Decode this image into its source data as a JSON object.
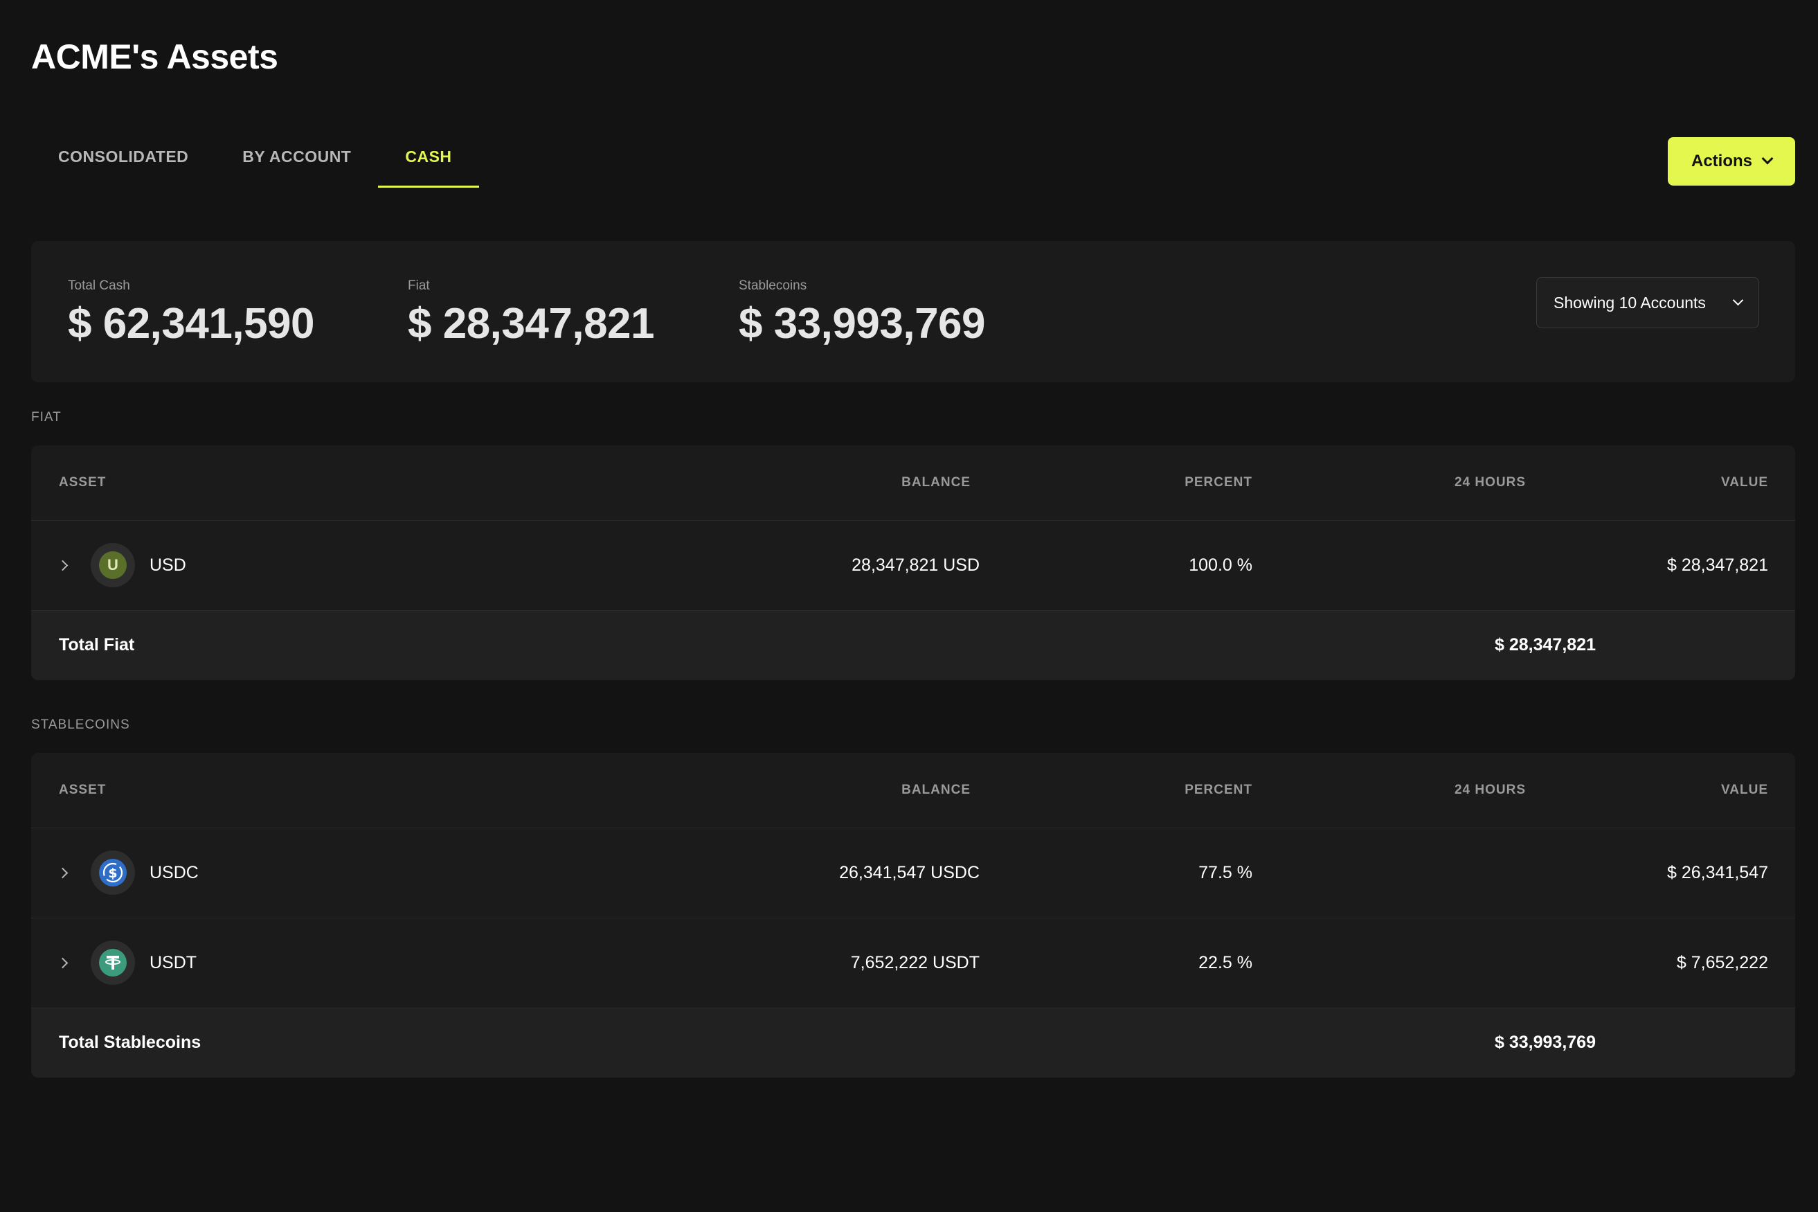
{
  "header": {
    "title": "ACME's Assets"
  },
  "tabs": [
    {
      "label": "CONSOLIDATED",
      "active": false
    },
    {
      "label": "BY ACCOUNT",
      "active": false
    },
    {
      "label": "CASH",
      "active": true
    }
  ],
  "actions": {
    "label": "Actions"
  },
  "summary": {
    "total_cash": {
      "label": "Total Cash",
      "value": "$ 62,341,590"
    },
    "fiat": {
      "label": "Fiat",
      "value": "$ 28,347,821"
    },
    "stablecoins": {
      "label": "Stablecoins",
      "value": "$ 33,993,769"
    },
    "accounts_select": "Showing 10 Accounts"
  },
  "columns": {
    "asset": "ASSET",
    "balance": "BALANCE",
    "percent": "PERCENT",
    "hours": "24 HOURS",
    "value": "VALUE"
  },
  "fiat": {
    "section_label": "FIAT",
    "rows": [
      {
        "icon": "usd-coin-icon",
        "icon_letter": "U",
        "icon_bg": "#5a6f2a",
        "icon_fg": "#dfe9b8",
        "name": "USD",
        "balance": "28,347,821 USD",
        "percent": "100.0 %",
        "hours": "",
        "value": "$ 28,347,821"
      }
    ],
    "total_label": "Total Fiat",
    "total_value": "$ 28,347,821"
  },
  "stablecoins": {
    "section_label": "STABLECOINS",
    "rows": [
      {
        "icon": "usdc-coin-icon",
        "icon_bg": "#2f6ec8",
        "icon_fg": "#ffffff",
        "name": "USDC",
        "balance": "26,341,547 USDC",
        "percent": "77.5 %",
        "hours": "",
        "value": "$ 26,341,547"
      },
      {
        "icon": "usdt-coin-icon",
        "icon_bg": "#3b9b7c",
        "icon_fg": "#ffffff",
        "name": "USDT",
        "balance": "7,652,222 USDT",
        "percent": "22.5 %",
        "hours": "",
        "value": "$ 7,652,222"
      }
    ],
    "total_label": "Total Stablecoins",
    "total_value": "$ 33,993,769"
  },
  "colors": {
    "background": "#131313",
    "card": "#1b1b1b",
    "accent": "#e4f74f"
  }
}
